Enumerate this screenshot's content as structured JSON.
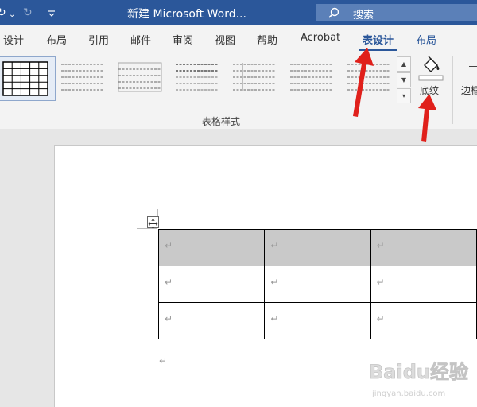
{
  "titlebar": {
    "quick_access": [
      "↻",
      "⌄",
      "↻",
      "⌄"
    ],
    "title": "新建 Microsoft Word...",
    "search_placeholder": "搜索"
  },
  "tabs": [
    {
      "label": "设计"
    },
    {
      "label": "布局"
    },
    {
      "label": "引用"
    },
    {
      "label": "邮件"
    },
    {
      "label": "审阅"
    },
    {
      "label": "视图"
    },
    {
      "label": "帮助"
    },
    {
      "label": "Acrobat"
    },
    {
      "label": "表设计",
      "active": true
    },
    {
      "label": "布局"
    }
  ],
  "ribbon": {
    "group_label": "表格样式",
    "shading_label": "底纹",
    "border_label": "边框",
    "gallery_up": "▲",
    "gallery_down": "▼",
    "gallery_more": "▾"
  },
  "document": {
    "paragraph_mark": "↵",
    "table": {
      "rows": 3,
      "cols": 3,
      "shaded_row": 0,
      "cells": [
        [
          "↵",
          "↵",
          "↵"
        ],
        [
          "↵",
          "↵",
          "↵"
        ],
        [
          "↵",
          "↵",
          "↵"
        ]
      ]
    }
  },
  "watermark": {
    "brand": "Baidu经验",
    "url": "jingyan.baidu.com"
  },
  "colors": {
    "title_bar": "#2b579a",
    "accent": "#2b579a",
    "shaded_cell": "#c9c9c9",
    "annotation_arrow": "#e0201b"
  }
}
